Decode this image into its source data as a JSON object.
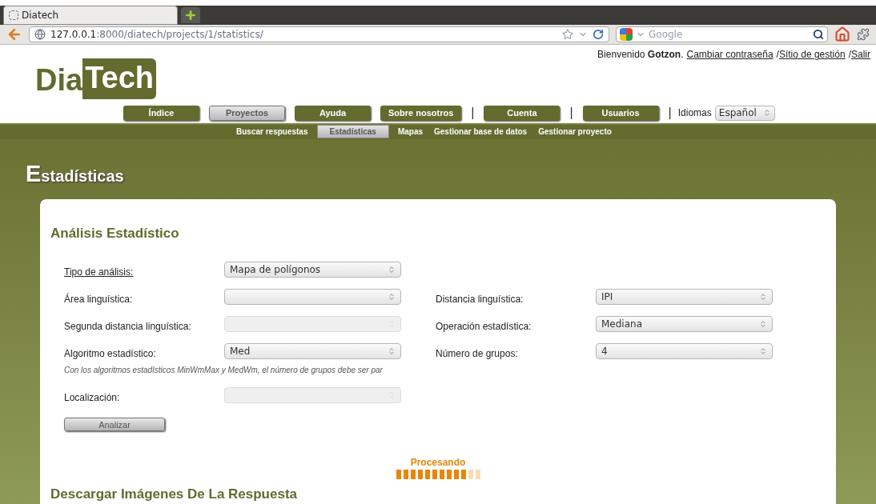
{
  "browser": {
    "tab_title": "Diatech",
    "url_host": "127.0.0.1",
    "url_path": ":8000/diatech/projects/1/statistics/",
    "search_placeholder": "Google"
  },
  "header": {
    "logo_left": "Dia",
    "logo_right": "Tech",
    "welcome": "Bienvenido **Gotzon**.",
    "user_links": [
      {
        "kind": "link",
        "label": "Cambiar contraseña"
      },
      {
        "kind": "separator",
        "label": "/"
      },
      {
        "kind": "link",
        "label": "Sítio de gestión"
      },
      {
        "kind": "separator",
        "label": "/"
      },
      {
        "kind": "link",
        "label": "Salir"
      }
    ]
  },
  "nav": {
    "items": [
      {
        "kind": "button",
        "label": "Índice",
        "selected": false
      },
      {
        "kind": "button",
        "label": "Proyectos",
        "selected": true
      },
      {
        "kind": "button",
        "label": "Ayuda",
        "selected": false
      },
      {
        "kind": "button",
        "label": "Sobre nosotros",
        "selected": false
      },
      {
        "kind": "separator",
        "label": "|"
      },
      {
        "kind": "button",
        "label": "Cuenta",
        "selected": false
      },
      {
        "kind": "separator",
        "label": "|"
      },
      {
        "kind": "button",
        "label": "Usuarios",
        "selected": false
      },
      {
        "kind": "separator",
        "label": "|"
      }
    ],
    "language_label": "Idiomas",
    "language_value": "Español"
  },
  "subnav": [
    {
      "label": "Buscar respuestas",
      "selected": false
    },
    {
      "label": "Estadísticas",
      "selected": true
    },
    {
      "label": "Mapas",
      "selected": false
    },
    {
      "label": "Gestionar base de datos",
      "selected": false
    },
    {
      "label": "Gestionar proyecto",
      "selected": false
    }
  ],
  "page_title": "Estadísticas",
  "card": {
    "title": "Análisis Estadístico",
    "rows": [
      {
        "left": {
          "label": "Tipo de análisis:",
          "underlined": true,
          "value": "Mapa de polígonos",
          "disabled": false
        }
      },
      {
        "left": {
          "label": "Área linguística:",
          "underlined": false,
          "disabled": false
        },
        "right": {
          "label": "Distancia linguística:",
          "underlined": false,
          "value": "IPI",
          "disabled": false
        }
      },
      {
        "left": {
          "label": "Segunda distancia linguística:",
          "underlined": false,
          "disabled": true
        },
        "right": {
          "label": "Operación estadística:",
          "underlined": false,
          "value": "Mediana",
          "disabled": false
        }
      },
      {
        "left": {
          "label": "Algoritmo estadístico:",
          "underlined": false,
          "value": "Med",
          "disabled": false,
          "note": "Con los algoritmos estadísticos MinWmMax y MedWm, el número de grupos debe ser par"
        },
        "right": {
          "label": "Número de grupos:",
          "underlined": false,
          "value": "4",
          "disabled": false
        }
      },
      {
        "left": {
          "label": "Localización:",
          "underlined": false,
          "disabled": true
        }
      }
    ],
    "button": "Analizar",
    "progress": {
      "label": "Procesando",
      "level": 0.83
    },
    "section_title": "Descargar Imágenes De La Respuesta"
  }
}
